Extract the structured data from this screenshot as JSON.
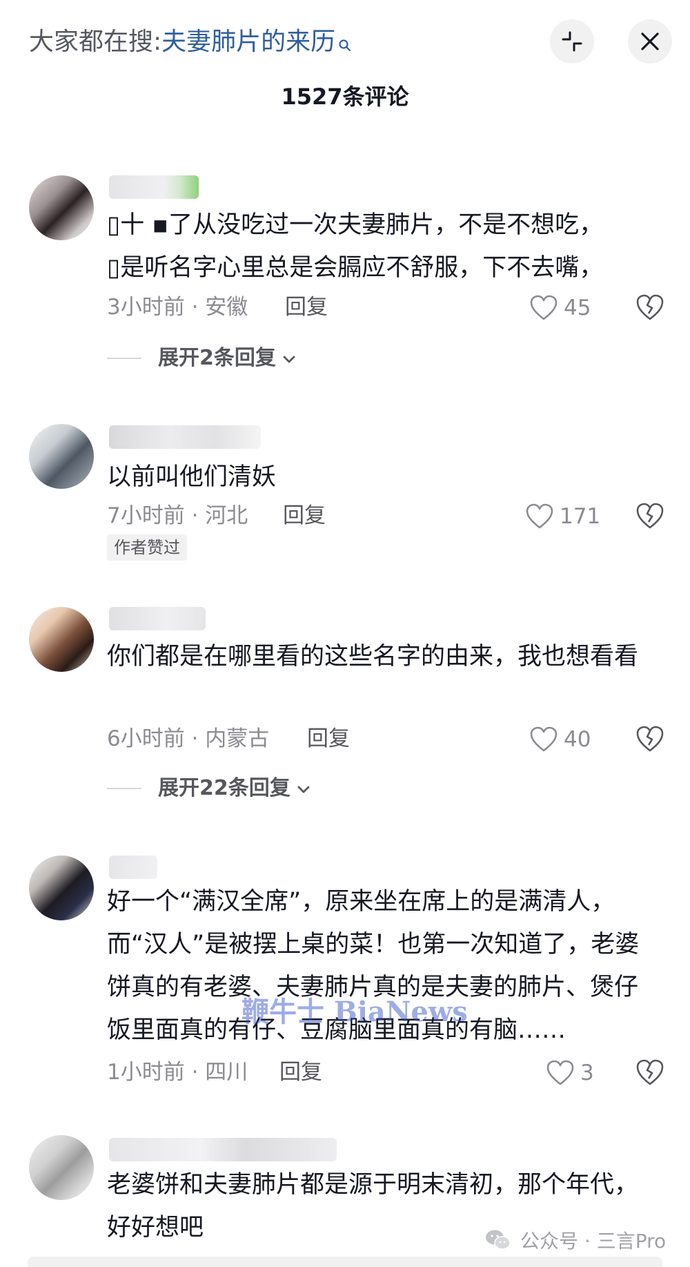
{
  "header": {
    "search_prefix": "大家都在搜:",
    "search_query": "夫妻肺片的来历",
    "comment_count": "1527条评论"
  },
  "comments": [
    {
      "text": "▯十 ▪了从没吃过一次夫妻肺片，不是不想吃，\n▯是听名字心里总是会膈应不舒服，下不去嘴，",
      "time_location": "3小时前 · 安徽",
      "reply": "回复",
      "likes": "45",
      "expand": "展开2条回复"
    },
    {
      "text": "以前叫他们清妖",
      "time_location": "7小时前 · 河北",
      "reply": "回复",
      "likes": "171",
      "badge": "作者赞过"
    },
    {
      "text": "你们都是在哪里看的这些名字的由来，我也想看看",
      "time_location": "6小时前 · 内蒙古",
      "reply": "回复",
      "likes": "40",
      "expand": "展开22条回复"
    },
    {
      "text": "好一个“满汉全席”，原来坐在席上的是满清人，而“汉人”是被摆上桌的菜！也第一次知道了，老婆饼真的有老婆、夫妻肺片真的是夫妻的肺片、煲仔饭里面真的有仔、豆腐脑里面真的有脑……",
      "time_location": "1小时前 · 四川",
      "reply": "回复",
      "likes": "3"
    },
    {
      "text": "老婆饼和夫妻肺片都是源于明末清初，那个年代，好好想吧"
    }
  ],
  "watermark": "鞭牛士 BiaNews",
  "source": "公众号 · 三言Pro",
  "icons": {
    "search": "search-icon",
    "collapse": "collapse-icon",
    "close": "close-icon",
    "like": "heart-icon",
    "dislike": "broken-heart-icon",
    "chevron": "chevron-down-icon",
    "wechat": "wechat-icon"
  },
  "colors": {
    "query_link": "#2f5f9e",
    "muted_text": "#8a8b91",
    "watermark": "#2846c8"
  }
}
